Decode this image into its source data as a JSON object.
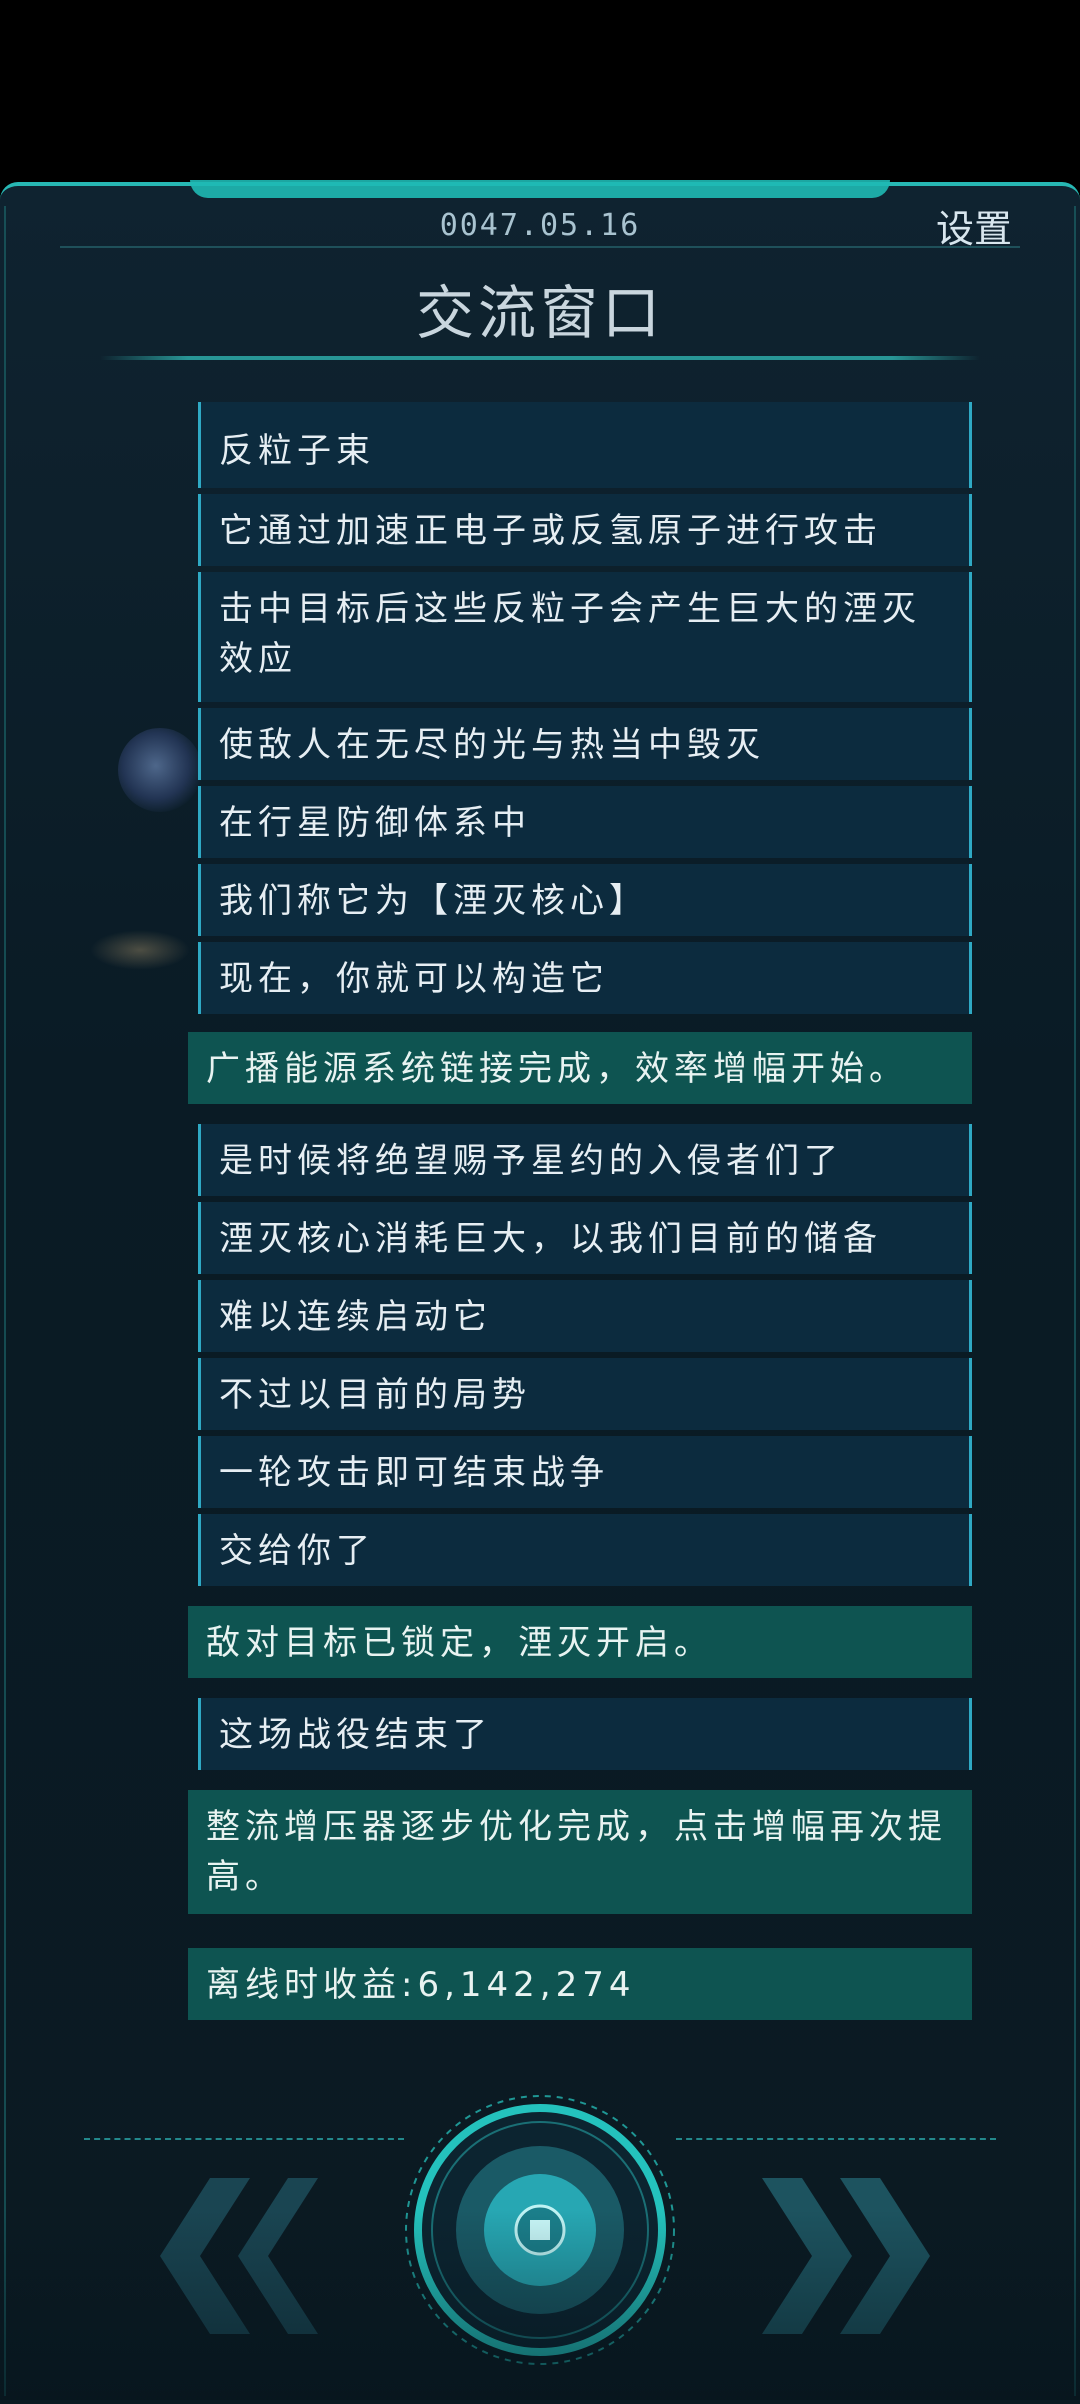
{
  "header": {
    "date": "0047.05.16",
    "settings_label": "设置",
    "title": "交流窗口"
  },
  "messages": [
    {
      "kind": "dialog",
      "text": "反粒子束"
    },
    {
      "kind": "dialog",
      "text": "它通过加速正电子或反氢原子进行攻击"
    },
    {
      "kind": "dialog",
      "text": "击中目标后这些反粒子会产生巨大的湮灭效应"
    },
    {
      "kind": "dialog",
      "text": "使敌人在无尽的光与热当中毁灭"
    },
    {
      "kind": "dialog",
      "text": "在行星防御体系中"
    },
    {
      "kind": "dialog",
      "text": "我们称它为【湮灭核心】"
    },
    {
      "kind": "dialog",
      "text": "现在，你就可以构造它"
    },
    {
      "kind": "system",
      "text": "广播能源系统链接完成，效率增幅开始。"
    },
    {
      "kind": "dialog",
      "text": "是时候将绝望赐予星约的入侵者们了"
    },
    {
      "kind": "dialog",
      "text": "湮灭核心消耗巨大，以我们目前的储备"
    },
    {
      "kind": "dialog",
      "text": "难以连续启动它"
    },
    {
      "kind": "dialog",
      "text": "不过以目前的局势"
    },
    {
      "kind": "dialog",
      "text": "一轮攻击即可结束战争"
    },
    {
      "kind": "dialog",
      "text": "交给你了"
    },
    {
      "kind": "system",
      "text": "敌对目标已锁定，湮灭开启。"
    },
    {
      "kind": "dialog",
      "text": "这场战役结束了"
    },
    {
      "kind": "system",
      "text": "整流增压器逐步优化完成，点击增幅再次提高。"
    },
    {
      "kind": "system",
      "text": "离线时收益:6,142,274"
    }
  ],
  "colors": {
    "accent": "#27b7b3",
    "dialog_bg": "#0c2b3e",
    "system_bg": "#0e5451",
    "background": "#0b1c26"
  },
  "controls": {
    "prev_icon": "double-chevron-left-icon",
    "next_icon": "double-chevron-right-icon",
    "center_icon": "core-button-icon"
  }
}
